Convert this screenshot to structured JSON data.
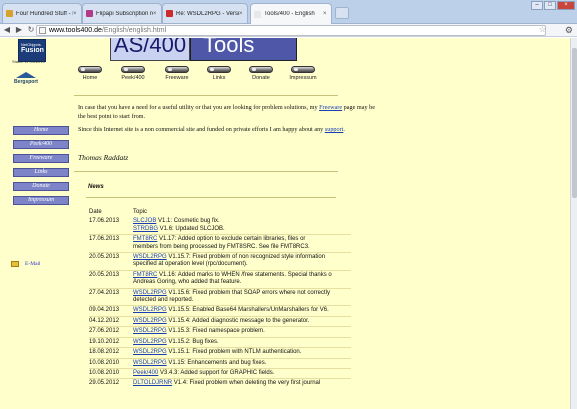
{
  "browser": {
    "tabs": [
      {
        "label": "Four Hundred Stuff - IBM i",
        "color": "#d9a02a"
      },
      {
        "label": "Flipapi Subscription result",
        "color": "#b13b88"
      },
      {
        "label": "Re: WSDL2RPG - Version 1",
        "color": "#cc2b2b"
      },
      {
        "label": "Tools/400 - English",
        "color": "#e8e8e8"
      }
    ],
    "url_host": "www.tools400.de",
    "url_path": "/English/english.html",
    "window_buttons": [
      "–",
      "□",
      "×"
    ]
  },
  "logo": {
    "line1": "NetObjects",
    "brand": "Fusion"
  },
  "date_stamp": "Stand: 17.06.2013",
  "bergsport": "Bergsport",
  "banner": {
    "left": "AS/400",
    "right": "Tools"
  },
  "nav": [
    {
      "label": "Home"
    },
    {
      "label": "Peek/400"
    },
    {
      "label": "Freeware"
    },
    {
      "label": "Links"
    },
    {
      "label": "Donate"
    },
    {
      "label": "Impressum"
    }
  ],
  "sidebar": [
    "Home",
    "Peek/400",
    "Freeware",
    "Links",
    "Donate",
    "Impressum"
  ],
  "email_label": "E-Mail",
  "intro": {
    "p1_before": "In case that you have a need for a useful utility or that you are looking for problem solutions, my ",
    "p1_link": "Freeware",
    "p1_after": " page may be the best point to start from.",
    "p2_before": "Since this Internet site is a non commercial site and funded on private efforts I am happy about any ",
    "p2_link": "support",
    "p2_after": "."
  },
  "signature": "Thomas Raddatz",
  "news_heading": "News",
  "news_header": {
    "date": "Date",
    "topic": "Topic"
  },
  "news": [
    {
      "date": "17.06.2013",
      "lines": [
        {
          "link": "SLCJOB",
          "text": " V1.1: Cosmetic bug fix."
        },
        {
          "link": "STRDBG",
          "text": " V1.6: Updated SLCJOB."
        }
      ]
    },
    {
      "date": "17.06.2013",
      "lines": [
        {
          "link": "FMT8RC",
          "text": " V1.17: Added option to exclude certain libraries, files or"
        },
        {
          "link": "",
          "text": "members from being processed by FMT8SRC. See file FMT8RC3."
        }
      ]
    },
    {
      "date": "20.05.2013",
      "lines": [
        {
          "link": "WSDL2RPG",
          "text": " V1.15.7: Fixed problem of non recognized style information"
        },
        {
          "link": "",
          "text": "specified at operation level (rpc/document)."
        }
      ]
    },
    {
      "date": "20.05.2013",
      "lines": [
        {
          "link": "FMT8RC",
          "text": " V1.16: Added marks to WHEN /free statements. Special thanks o"
        },
        {
          "link": "",
          "text": "Andreas Goring, who added that feature."
        }
      ]
    },
    {
      "date": "27.04.2013",
      "lines": [
        {
          "link": "WSDL2RPG",
          "text": " V1.15.6: Fixed problem that SOAP errors where not correctly"
        },
        {
          "link": "",
          "text": "detected and reported."
        }
      ]
    },
    {
      "date": "09.04.2013",
      "lines": [
        {
          "link": "WSDL2RPG",
          "text": " V1.15.5: Enabled Base64 Marshallers/UnMarshallers for V6."
        }
      ]
    },
    {
      "date": "04.12.2012",
      "lines": [
        {
          "link": "WSDL2RPG",
          "text": " V1.15.4: Added diagnostic message to the generator."
        }
      ]
    },
    {
      "date": "27.06.2012",
      "lines": [
        {
          "link": "WSDL2RPG",
          "text": " V1.15.3: Fixed namespace problem."
        }
      ]
    },
    {
      "date": "19.10.2012",
      "lines": [
        {
          "link": "WSDL2RPG",
          "text": " V1.15.2: Bug fixes."
        }
      ]
    },
    {
      "date": "18.08.2012",
      "lines": [
        {
          "link": "WSDL2RPG",
          "text": " V1.15.1: Fixed problem with NTLM authentication."
        }
      ]
    },
    {
      "date": "10.08.2010",
      "lines": [
        {
          "link": "WSDL2RPG",
          "text": " V1.15: Enhancements and bug fixes."
        }
      ]
    },
    {
      "date": "10.08.2010",
      "lines": [
        {
          "link": "Peek/400",
          "text": " V3.4.3: Added support for GRAPHIC fields."
        }
      ]
    },
    {
      "date": "29.05.2012",
      "lines": [
        {
          "link": "DLTOLDJRNR",
          "text": " V1.4: Fixed problem when deleting the very first journal"
        }
      ]
    }
  ]
}
